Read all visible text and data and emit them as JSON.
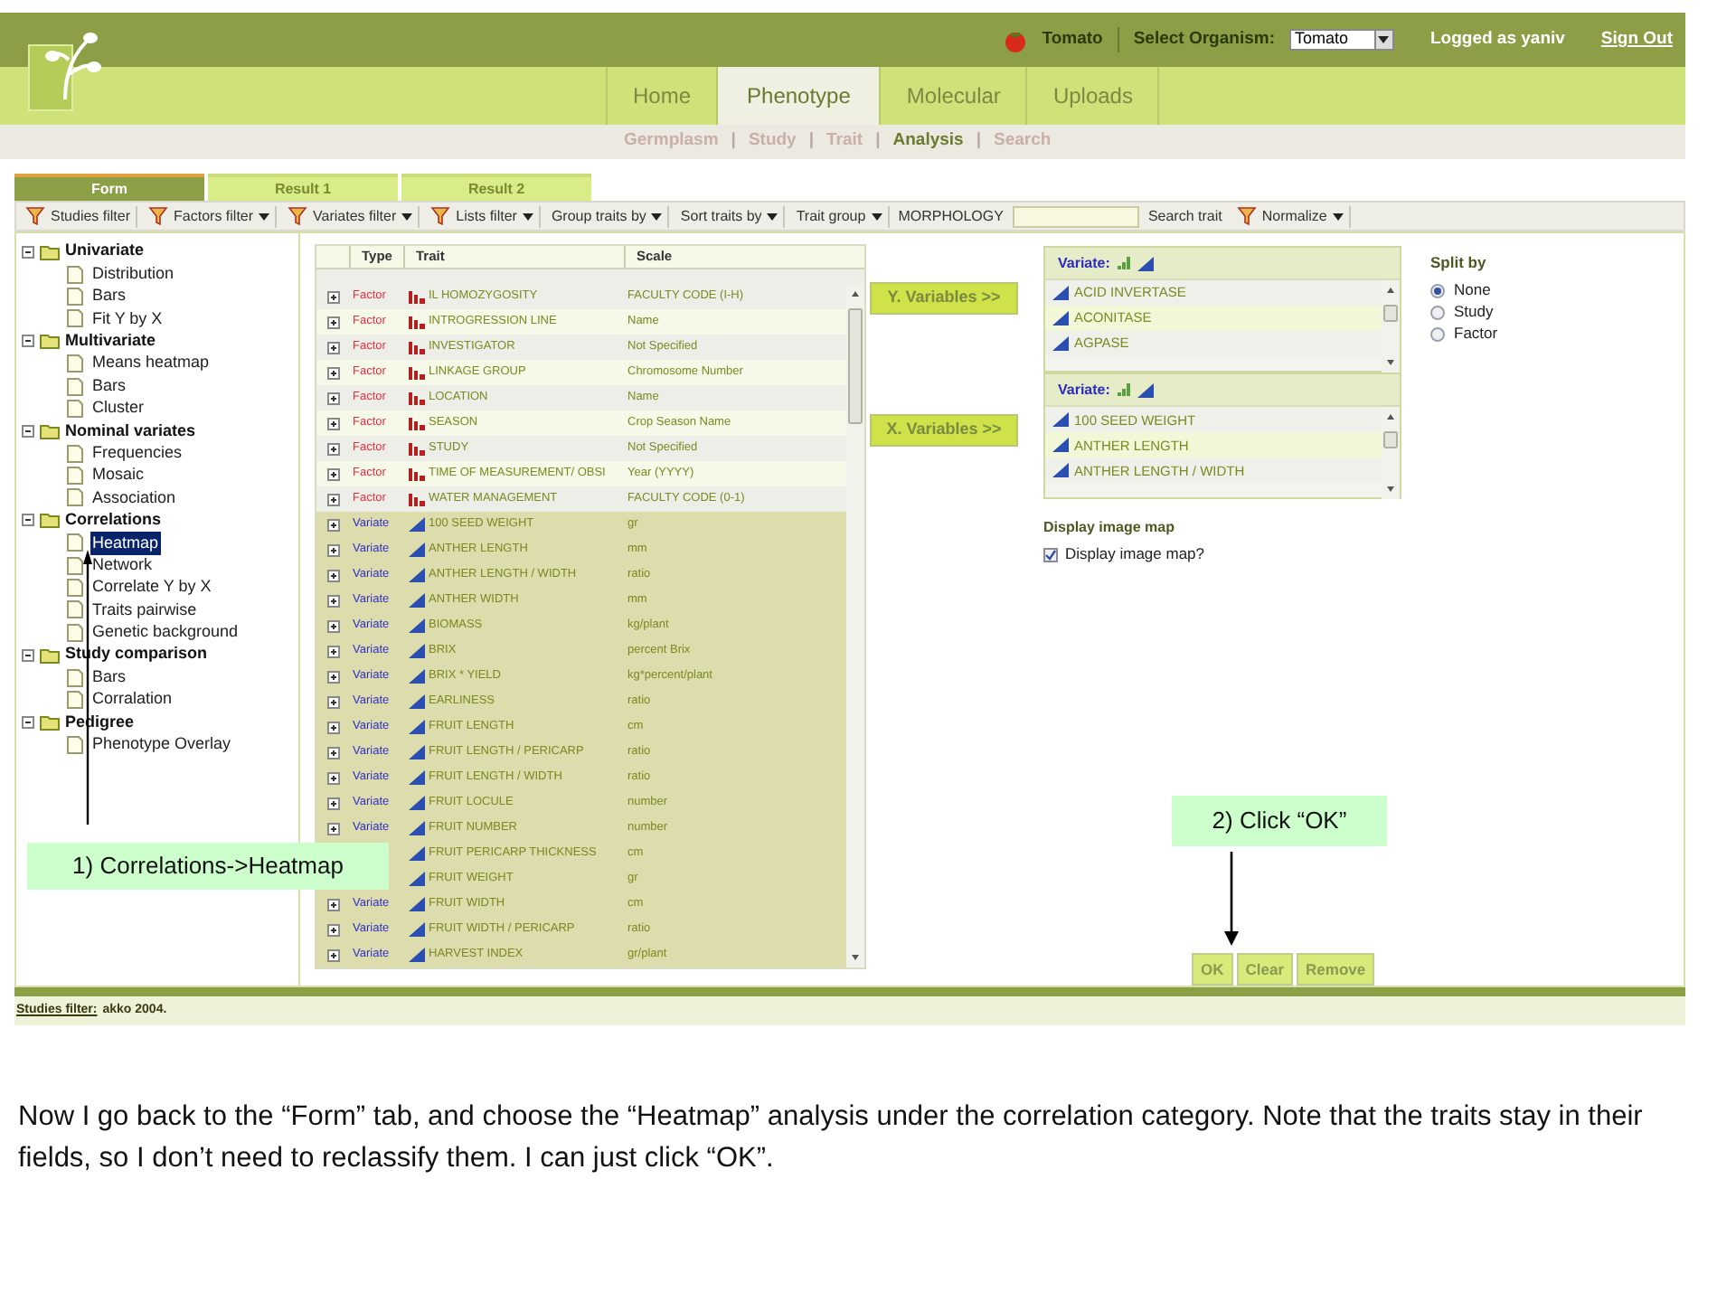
{
  "header": {
    "organism": "Tomato",
    "select_label": "Select Organism:",
    "select_value": "Tomato",
    "user": "Logged as yaniv",
    "sign_out": "Sign Out"
  },
  "nav": [
    {
      "label": "Home",
      "selected": false
    },
    {
      "label": "Phenotype",
      "selected": true
    },
    {
      "label": "Molecular",
      "selected": false
    },
    {
      "label": "Uploads",
      "selected": false
    }
  ],
  "subnav": {
    "separator": "|",
    "items": [
      {
        "label": "Germplasm",
        "selected": false
      },
      {
        "label": "Study",
        "selected": false
      },
      {
        "label": "Trait",
        "selected": false
      },
      {
        "label": "Analysis",
        "selected": true
      },
      {
        "label": "Search",
        "selected": false
      }
    ]
  },
  "form_tabs": [
    {
      "label": "Form",
      "selected": true
    },
    {
      "label": "Result 1",
      "selected": false
    },
    {
      "label": "Result 2",
      "selected": false
    }
  ],
  "toolbar": [
    {
      "kind": "filter",
      "label": "Studies filter"
    },
    {
      "kind": "filter_menu",
      "label": "Factors filter"
    },
    {
      "kind": "filter_menu",
      "label": "Variates filter"
    },
    {
      "kind": "filter_menu",
      "label": "Lists filter"
    },
    {
      "kind": "menu",
      "label": "Group traits by"
    },
    {
      "kind": "menu",
      "label": "Sort traits by"
    },
    {
      "kind": "menu",
      "label": "Trait group"
    },
    {
      "kind": "text",
      "label": "MORPHOLOGY"
    },
    {
      "kind": "field"
    },
    {
      "kind": "text",
      "label": "Search trait"
    },
    {
      "kind": "filter_menu",
      "label": "Normalize"
    }
  ],
  "tree": [
    {
      "label": "Univariate",
      "expanded": true,
      "children": [
        {
          "label": "Distribution",
          "selected": false
        },
        {
          "label": "Bars",
          "selected": false
        },
        {
          "label": "Fit Y by X",
          "selected": false
        }
      ]
    },
    {
      "label": "Multivariate",
      "expanded": true,
      "children": [
        {
          "label": "Means heatmap",
          "selected": false
        },
        {
          "label": "Bars",
          "selected": false
        },
        {
          "label": "Cluster",
          "selected": false
        }
      ]
    },
    {
      "label": "Nominal variates",
      "expanded": true,
      "children": [
        {
          "label": "Frequencies",
          "selected": false
        },
        {
          "label": "Mosaic",
          "selected": false
        },
        {
          "label": "Association",
          "selected": false
        }
      ]
    },
    {
      "label": "Correlations",
      "expanded": true,
      "children": [
        {
          "label": "Heatmap",
          "selected": true
        },
        {
          "label": "Network",
          "selected": false
        },
        {
          "label": "Correlate Y by X",
          "selected": false
        },
        {
          "label": "Traits pairwise",
          "selected": false
        },
        {
          "label": "Genetic background",
          "selected": false
        }
      ]
    },
    {
      "label": "Study comparison",
      "expanded": true,
      "children": [
        {
          "label": "Bars",
          "selected": false
        },
        {
          "label": "Corralation",
          "selected": false
        }
      ]
    },
    {
      "label": "Pedigree",
      "expanded": true,
      "children": [
        {
          "label": "Phenotype Overlay",
          "selected": false
        }
      ]
    }
  ],
  "table": {
    "columns": [
      "Type",
      "Trait",
      "Scale"
    ],
    "rows": [
      {
        "kind": "factor",
        "type": "Factor",
        "trait": "IL HOMOZYGOSITY",
        "scale": "FACULTY CODE (I-H)"
      },
      {
        "kind": "factor",
        "type": "Factor",
        "trait": "INTROGRESSION LINE",
        "scale": "Name"
      },
      {
        "kind": "factor",
        "type": "Factor",
        "trait": "INVESTIGATOR",
        "scale": "Not Specified"
      },
      {
        "kind": "factor",
        "type": "Factor",
        "trait": "LINKAGE GROUP",
        "scale": "Chromosome Number"
      },
      {
        "kind": "factor",
        "type": "Factor",
        "trait": "LOCATION",
        "scale": "Name"
      },
      {
        "kind": "factor",
        "type": "Factor",
        "trait": "SEASON",
        "scale": "Crop Season Name"
      },
      {
        "kind": "factor",
        "type": "Factor",
        "trait": "STUDY",
        "scale": "Not Specified"
      },
      {
        "kind": "factor",
        "type": "Factor",
        "trait": "TIME OF MEASUREMENT/ OBSI",
        "scale": "Year (YYYY)"
      },
      {
        "kind": "factor",
        "type": "Factor",
        "trait": "WATER MANAGEMENT",
        "scale": "FACULTY CODE (0-1)"
      },
      {
        "kind": "variate",
        "type": "Variate",
        "trait": "100 SEED WEIGHT",
        "scale": "gr"
      },
      {
        "kind": "variate",
        "type": "Variate",
        "trait": "ANTHER LENGTH",
        "scale": "mm"
      },
      {
        "kind": "variate",
        "type": "Variate",
        "trait": "ANTHER LENGTH / WIDTH",
        "scale": "ratio"
      },
      {
        "kind": "variate",
        "type": "Variate",
        "trait": "ANTHER WIDTH",
        "scale": "mm"
      },
      {
        "kind": "variate",
        "type": "Variate",
        "trait": "BIOMASS",
        "scale": "kg/plant"
      },
      {
        "kind": "variate",
        "type": "Variate",
        "trait": "BRIX",
        "scale": "percent Brix"
      },
      {
        "kind": "variate",
        "type": "Variate",
        "trait": "BRIX * YIELD",
        "scale": "kg*percent/plant"
      },
      {
        "kind": "variate",
        "type": "Variate",
        "trait": "EARLINESS",
        "scale": "ratio"
      },
      {
        "kind": "variate",
        "type": "Variate",
        "trait": "FRUIT LENGTH",
        "scale": "cm"
      },
      {
        "kind": "variate",
        "type": "Variate",
        "trait": "FRUIT LENGTH / PERICARP",
        "scale": "ratio"
      },
      {
        "kind": "variate",
        "type": "Variate",
        "trait": "FRUIT LENGTH / WIDTH",
        "scale": "ratio"
      },
      {
        "kind": "variate",
        "type": "Variate",
        "trait": "FRUIT LOCULE",
        "scale": "number"
      },
      {
        "kind": "variate",
        "type": "Variate",
        "trait": "FRUIT NUMBER",
        "scale": "number"
      },
      {
        "kind": "variate",
        "trait": "FRUIT PERICARP THICKNESS",
        "scale": "cm"
      },
      {
        "kind": "variate",
        "trait": "FRUIT WEIGHT",
        "scale": "gr"
      },
      {
        "kind": "variate",
        "type": "Variate",
        "trait": "FRUIT WIDTH",
        "scale": "cm"
      },
      {
        "kind": "variate",
        "type": "Variate",
        "trait": "FRUIT WIDTH / PERICARP",
        "scale": "ratio"
      },
      {
        "kind": "variate",
        "type": "Variate",
        "trait": "HARVEST INDEX",
        "scale": "gr/plant"
      }
    ]
  },
  "y_button": "Y. Variables >>",
  "x_button": "X. Variables >>",
  "y_list": {
    "header": "Variate:",
    "items": [
      "ACID INVERTASE",
      "ACONITASE",
      "AGPASE"
    ]
  },
  "x_list": {
    "header": "Variate:",
    "items": [
      "100 SEED WEIGHT",
      "ANTHER LENGTH",
      "ANTHER LENGTH / WIDTH"
    ]
  },
  "image_map": {
    "title": "Display image map",
    "label": "Display image map?",
    "checked": true
  },
  "split_by": {
    "title": "Split by",
    "options": [
      {
        "label": "None",
        "selected": true
      },
      {
        "label": "Study",
        "selected": false
      },
      {
        "label": "Factor",
        "selected": false
      }
    ]
  },
  "buttons": [
    "OK",
    "Clear",
    "Remove"
  ],
  "footer": {
    "link": "Studies filter:",
    "text": "akko 2004."
  },
  "callouts": [
    "1) Correlations->Heatmap",
    "2) Click “OK”"
  ],
  "caption": "Now I go back to the “Form” tab, and choose the “Heatmap” analysis under the correlation category. Note that the traits stay in their fields, so I don’t need to reclassify them. I can just click “OK”."
}
